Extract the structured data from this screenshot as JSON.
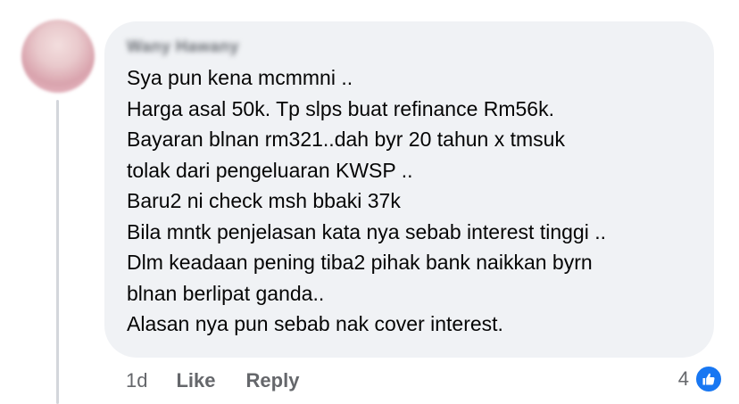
{
  "comment": {
    "author": "Wany Hawany",
    "lines": [
      "Sya pun kena mcmmni ..",
      "Harga asal 50k. Tp slps buat refinance Rm56k.",
      "Bayaran blnan rm321..dah byr 20 tahun x tmsuk",
      "tolak dari pengeluaran KWSP ..",
      "Baru2 ni check msh bbaki 37k",
      "Bila mntk penjelasan kata nya sebab interest tinggi ..",
      "Dlm keadaan pening tiba2 pihak bank naikkan byrn",
      "blnan berlipat ganda..",
      "Alasan nya pun sebab nak cover interest."
    ],
    "bubble_color": "#f0f2f5"
  },
  "actions": {
    "time": "1d",
    "like_label": "Like",
    "reply_label": "Reply"
  },
  "reactions": {
    "count": "4",
    "icon": "thumbs-up-icon",
    "color": "#1877f2"
  }
}
